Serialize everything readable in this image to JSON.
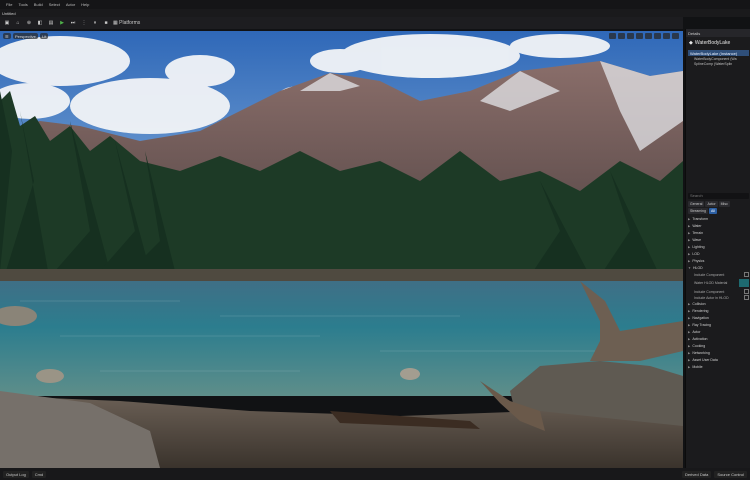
{
  "menu": [
    "File",
    "Tools",
    "Build",
    "Select",
    "Actor",
    "Help"
  ],
  "window": {
    "title": "Untitled"
  },
  "toolbar": {
    "platforms_label": "Platforms"
  },
  "viewport": {
    "perspective_label": "Perspective",
    "lit_label": "Lit"
  },
  "details": {
    "tab_label": "Details",
    "actor_name": "WaterBodyLake",
    "selected_component": "WaterBodyLake (Instance)",
    "components": [
      "WaterBodyComponent (Wa",
      "SplineComp (WaterSplin"
    ],
    "search_placeholder": "Search",
    "filters": [
      "General",
      "Actor",
      "Misc",
      "Streaming",
      "All"
    ],
    "categories": [
      "Transform",
      "Water",
      "Terrain",
      "Wave",
      "Lighting",
      "LOD",
      "Physics",
      "HLOD",
      "Collision",
      "Rendering",
      "Navigation",
      "Ray Tracing",
      "Actor",
      "Activation",
      "Cooking",
      "Networking",
      "Asset User Data",
      "Mobile"
    ],
    "props": [
      "Include Component",
      "Water HLOD Material",
      "Include Component",
      "Include Actor in HLOD"
    ]
  },
  "status": {
    "output_log": "Output Log",
    "cmd": "Cmd",
    "derived_data": "Derived Data",
    "source_control": "Source Control"
  }
}
